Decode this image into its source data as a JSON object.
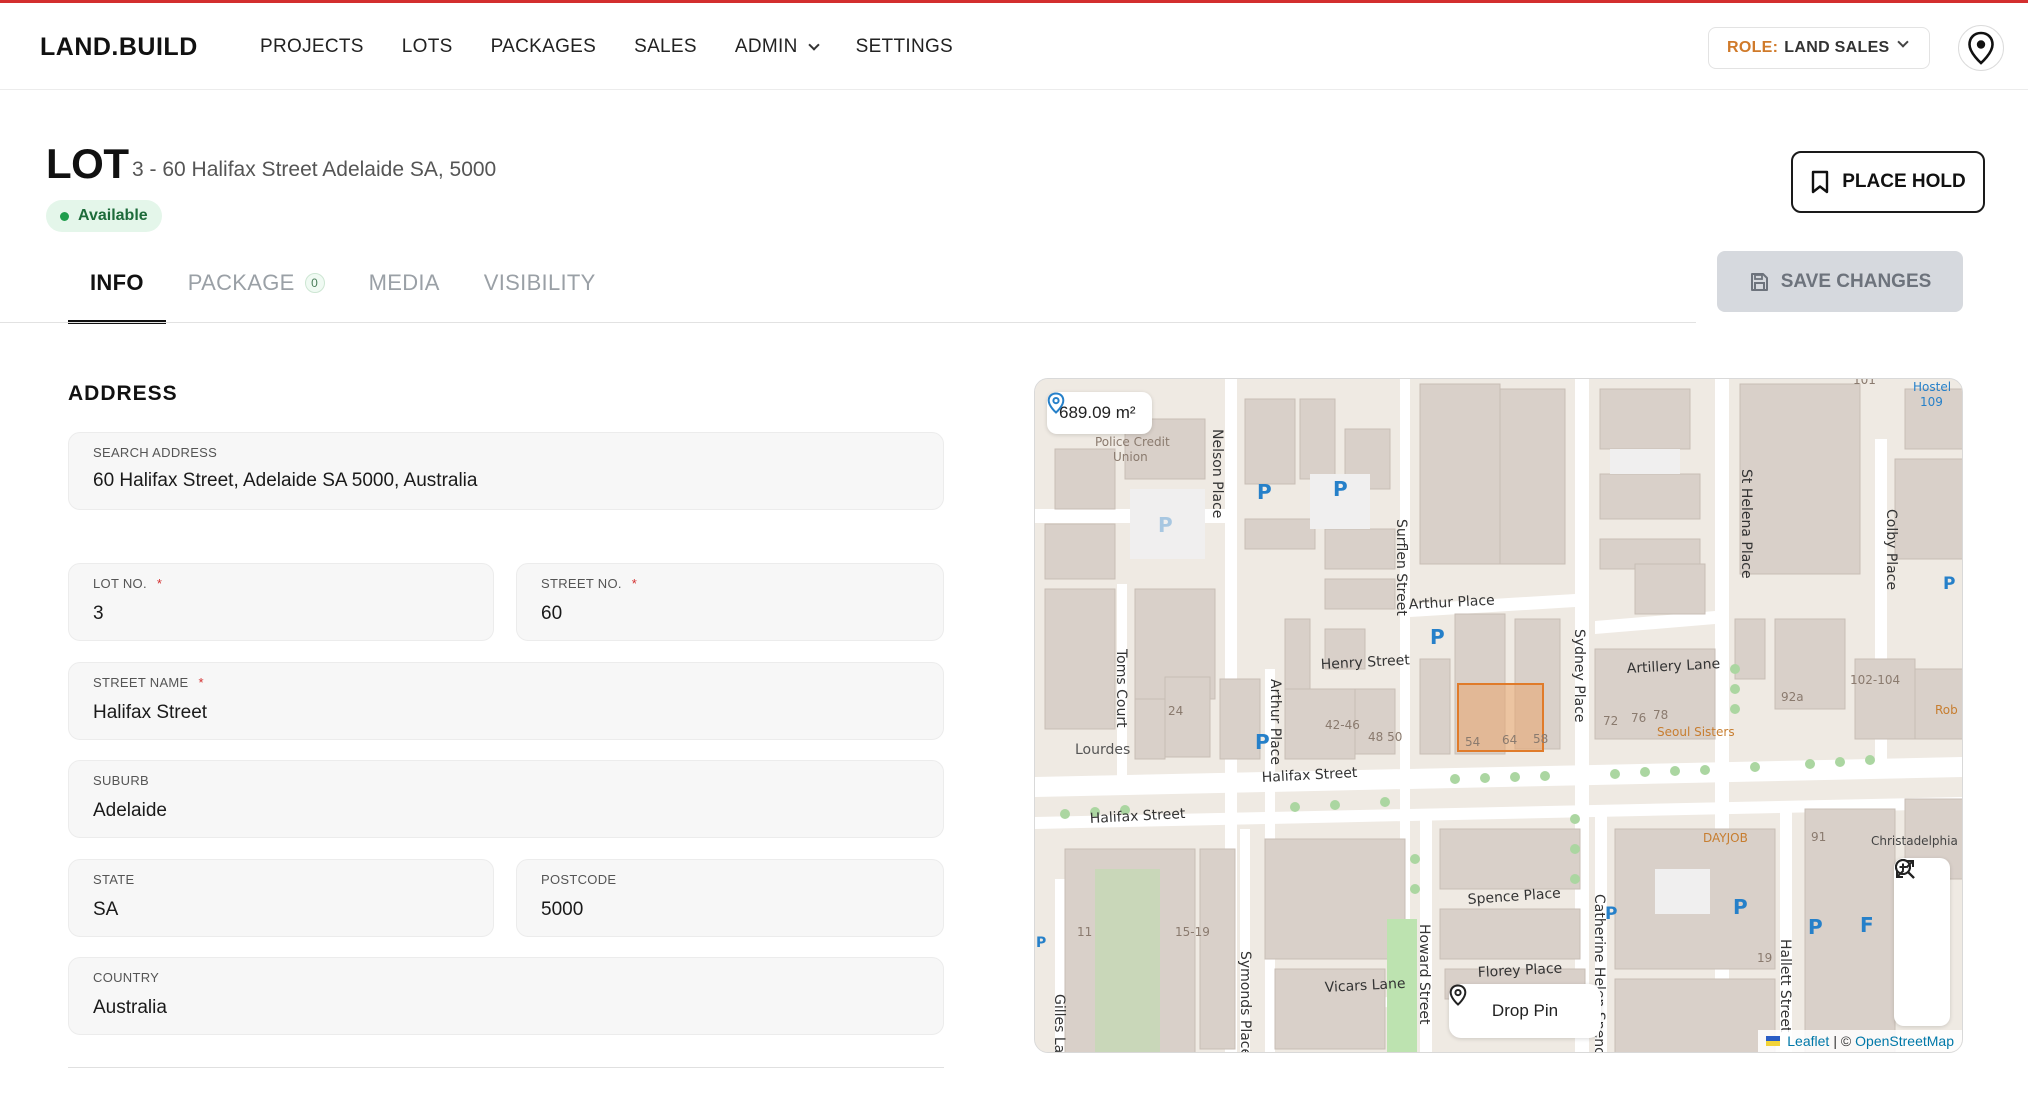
{
  "header": {
    "logo": "LAND.BUILD",
    "nav": [
      {
        "label": "PROJECTS"
      },
      {
        "label": "LOTS"
      },
      {
        "label": "PACKAGES"
      },
      {
        "label": "SALES"
      },
      {
        "label": "ADMIN"
      },
      {
        "label": "SETTINGS"
      }
    ],
    "role_key": "ROLE:",
    "role_value": "LAND SALES"
  },
  "lot": {
    "title": "LOT",
    "subtitle": "3 - 60 Halifax Street Adelaide SA, 5000",
    "status": "Available",
    "place_hold_label": "PLACE HOLD",
    "save_changes_label": "SAVE CHANGES"
  },
  "tabs": [
    {
      "label": "INFO"
    },
    {
      "label": "PACKAGE",
      "count": "0"
    },
    {
      "label": "MEDIA"
    },
    {
      "label": "VISIBILITY"
    }
  ],
  "address": {
    "section_title": "ADDRESS",
    "search": {
      "label": "SEARCH ADDRESS",
      "value": "60 Halifax Street, Adelaide SA 5000, Australia"
    },
    "lot_no": {
      "label": "LOT NO.",
      "required": "*",
      "value": "3"
    },
    "street_no": {
      "label": "STREET NO.",
      "required": "*",
      "value": "60"
    },
    "street_name": {
      "label": "STREET NAME",
      "required": "*",
      "value": "Halifax Street"
    },
    "suburb": {
      "label": "SUBURB",
      "value": "Adelaide"
    },
    "state": {
      "label": "STATE",
      "value": "SA"
    },
    "postcode": {
      "label": "POSTCODE",
      "value": "5000"
    },
    "country": {
      "label": "COUNTRY",
      "value": "Australia"
    }
  },
  "map": {
    "area": "689.09 m²",
    "drop_pin_label": "Drop Pin",
    "attribution_leaflet": "Leaflet",
    "attribution_sep": "| ©",
    "attribution_osm": "OpenStreetMap",
    "street_labels": [
      "Halifax Street",
      "Halifax Street",
      "Henry Street",
      "Arthur Place",
      "Artillery Lane",
      "Spence Place",
      "Florey Place",
      "Vicars Lane",
      "Nelson Place",
      "Surflen Street",
      "Sydney Place",
      "St Helena Place",
      "Colby Place",
      "Toms Court",
      "Symonds Place",
      "Howard Street",
      "Catherine Helen Spence",
      "Hallett Street",
      "Gilles Lane",
      "Arthur Place"
    ],
    "poi_labels": [
      "Police Credit Union",
      "Lourdes",
      "Seoul Sisters",
      "DAYJOB",
      "Christadelphia",
      "Hostel 109",
      "Rob Hot"
    ],
    "house_numbers": [
      "24",
      "42-46",
      "48 50",
      "54",
      "64",
      "58",
      "72",
      "76",
      "78",
      "92a",
      "102-104",
      "91",
      "11",
      "15-19",
      "19",
      "101"
    ],
    "colors": {
      "lot_outline": "#e07b2a",
      "lot_fill": "#e9a46b",
      "building": "#d9d0c9",
      "road": "#ffffff",
      "parking": "#2680c9",
      "tree": "#abd6a1"
    }
  }
}
